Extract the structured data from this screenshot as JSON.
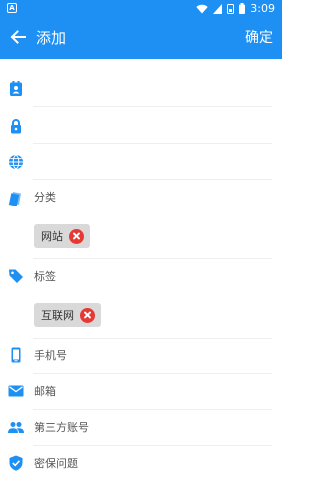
{
  "statusbar": {
    "time": "3:09",
    "icons": [
      "app-a-icon",
      "wifi-icon",
      "signal-icon",
      "sim-icon",
      "battery-icon"
    ]
  },
  "appbar": {
    "title": "添加",
    "confirm": "确定",
    "color": "#1E90F4"
  },
  "fields": [
    {
      "icon": "contact-card-icon",
      "value": ""
    },
    {
      "icon": "lock-icon",
      "value": ""
    },
    {
      "icon": "globe-icon",
      "value": ""
    }
  ],
  "category": {
    "icon": "tag-stack-icon",
    "label": "分类",
    "chip": "网站"
  },
  "tags": {
    "icon": "tag-icon",
    "label": "标签",
    "chip": "互联网"
  },
  "items": [
    {
      "icon": "phone-icon",
      "label": "手机号"
    },
    {
      "icon": "mail-icon",
      "label": "邮箱"
    },
    {
      "icon": "people-icon",
      "label": "第三方账号"
    },
    {
      "icon": "shield-icon",
      "label": "密保问题"
    }
  ],
  "colors": {
    "accent": "#1E90F4",
    "remove": "#e53935",
    "chip_bg": "#d9d9d9"
  }
}
